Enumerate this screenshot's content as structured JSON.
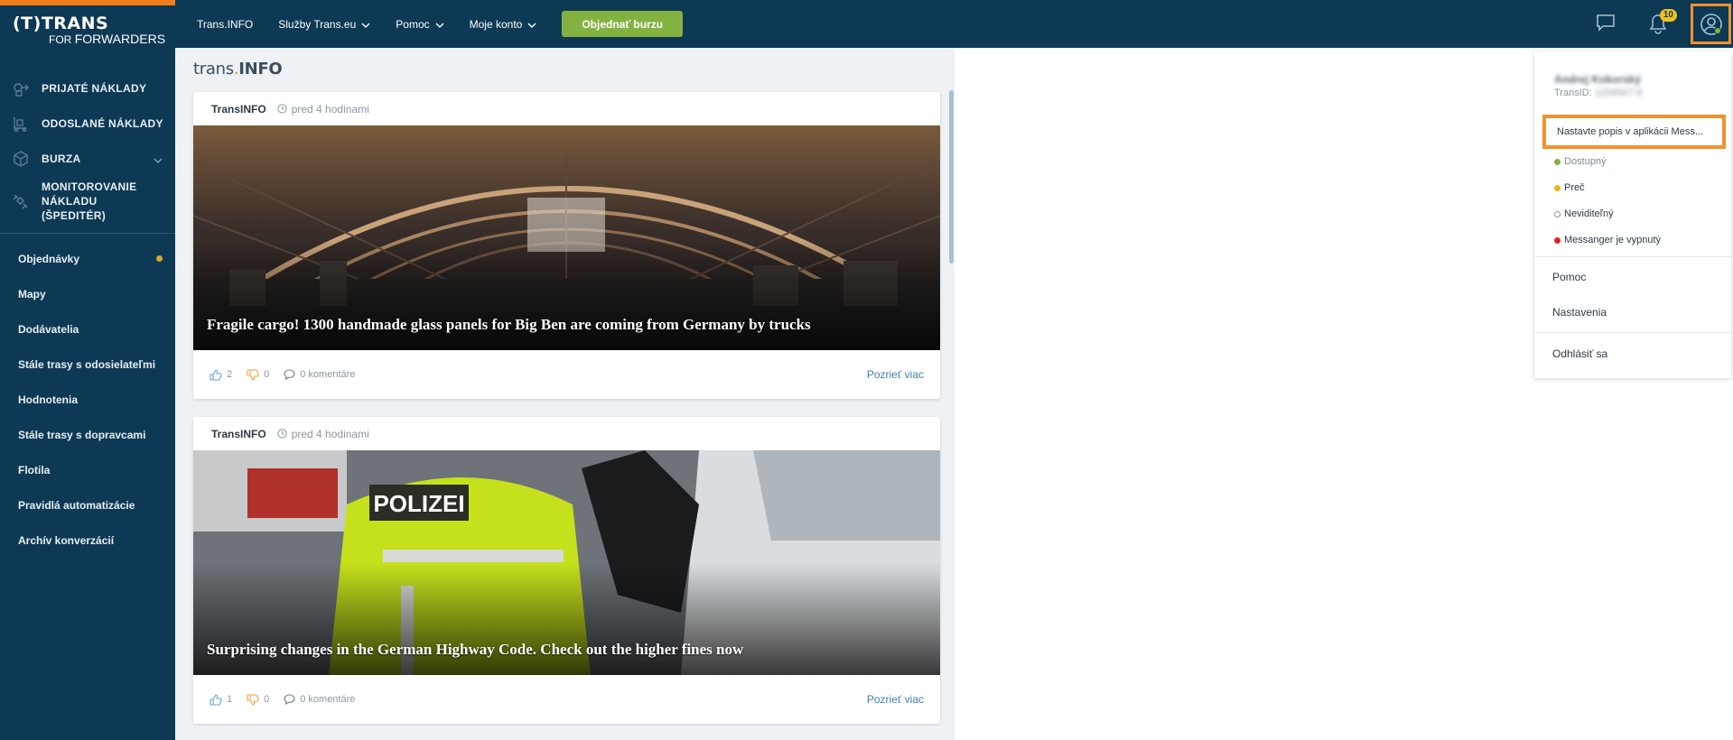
{
  "logo": {
    "top": "(T)TRANS",
    "for": "FOR",
    "forwarders": "FORWARDERS"
  },
  "sidebar": {
    "main_items": [
      {
        "label": "PRIJATÉ NÁKLADY",
        "icon": "incoming-cargo-icon"
      },
      {
        "label": "ODOSLANÉ NÁKLADY",
        "icon": "outgoing-cargo-icon"
      },
      {
        "label": "BURZA",
        "icon": "box-icon"
      },
      {
        "label": "MONITOROVANIE NÁKLADU (ŠPEDITÉR)",
        "icon": "satellite-icon"
      }
    ],
    "sub_items": [
      {
        "label": "Objednávky",
        "dot_color": "#d9a82b"
      },
      {
        "label": "Mapy"
      },
      {
        "label": "Dodávatelia"
      },
      {
        "label": "Stále trasy s odosielateľmi"
      },
      {
        "label": "Hodnotenia"
      },
      {
        "label": "Stále trasy s dopravcami"
      },
      {
        "label": "Flotila"
      },
      {
        "label": "Pravidlá automatizácie"
      },
      {
        "label": "Archív konverzácií"
      }
    ]
  },
  "topbar": {
    "nav": [
      {
        "label": "Trans.INFO"
      },
      {
        "label": "Služby Trans.eu"
      },
      {
        "label": "Pomoc"
      },
      {
        "label": "Moje konto"
      }
    ],
    "order_button": "Objednať burzu",
    "notifications_count": "10"
  },
  "feed": {
    "brand_prefix": "trans",
    "brand_dot": ".",
    "brand_suffix": "INFO",
    "cards": [
      {
        "source": "TransINFO",
        "time": "pred 4 hodinami",
        "title": "Fragile cargo! 1300 handmade glass panels for  Big Ben are coming from Germany by trucks",
        "likes": "2",
        "dislikes": "0",
        "comments": "0 komentáre",
        "more": "Pozrieť viac"
      },
      {
        "source": "TransINFO",
        "time": "pred 4 hodinami",
        "title": "Surprising changes in the German Highway Code. Check out the higher fines now",
        "likes": "1",
        "dislikes": "0",
        "comments": "0 komentáre",
        "more": "Pozrieť viac"
      }
    ]
  },
  "dropdown": {
    "user_name": "Andrej Kokorský",
    "trans_id_label": "TransID:",
    "trans_id_value": "1234567-8",
    "status_input": "Nastavte popis v aplikácii Mess...",
    "statuses": [
      {
        "label": "Dostupný",
        "color": "#84b240",
        "muted": true
      },
      {
        "label": "Preč",
        "color": "#e6b81c"
      },
      {
        "label": "Neviditeľný",
        "color": "#ffffff"
      },
      {
        "label": "Messanger je vypnutý",
        "color": "#e02424"
      }
    ],
    "links": [
      "Pomoc",
      "Nastavenia",
      "Odhlásiť sa"
    ]
  }
}
